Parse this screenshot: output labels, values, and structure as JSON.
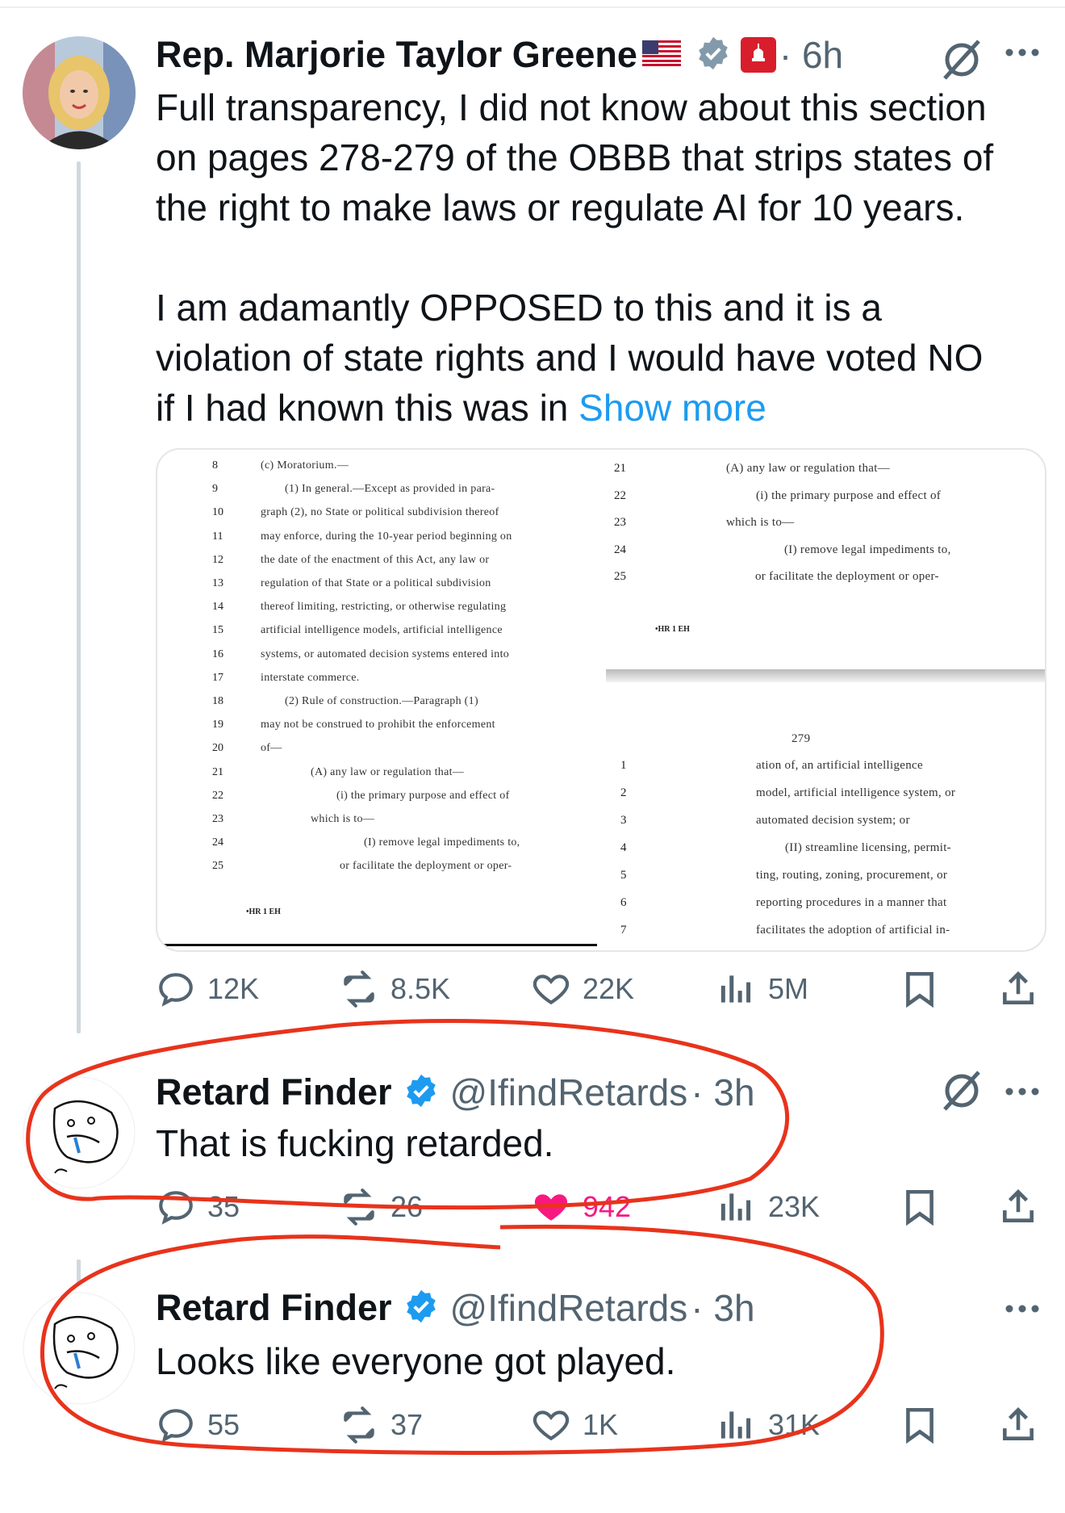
{
  "colors": {
    "accent_link": "#1d9bf0",
    "verified": "#1d9bf0",
    "gop_badge": "#d81e2c",
    "like_active": "#f91880",
    "annotation": "#e8331c",
    "muted": "#536471"
  },
  "posts": [
    {
      "name": "Rep. Marjorie Taylor Greene",
      "flag_icon": "us-flag-icon",
      "verified_icon": "gray-verified-badge-icon",
      "affiliate_icon": "gop-badge-icon",
      "time": "· 6h",
      "body_lines": [
        "Full transparency, I did not know about this section",
        "on pages 278-279 of the OBBB that strips states of",
        "the right to make laws or regulate AI for 10 years.",
        "",
        "I am adamantly OPPOSED to this and it is a",
        "violation of state rights and I would have voted NO",
        "if I had known this was in"
      ],
      "show_more": "Show more",
      "stats": {
        "replies": "12K",
        "reposts": "8.5K",
        "likes": "22K",
        "views": "5M"
      }
    },
    {
      "name": "Retard Finder",
      "verified_icon": "blue-verified-badge-icon",
      "handle": "@IfindRetards",
      "time": "· 3h",
      "body": "That is fucking retarded.",
      "stats": {
        "replies": "35",
        "reposts": "26",
        "likes": "942",
        "views": "23K"
      }
    },
    {
      "name": "Retard Finder",
      "verified_icon": "blue-verified-badge-icon",
      "handle": "@IfindRetards",
      "time": "· 3h",
      "body": "Looks like everyone got played.",
      "stats": {
        "replies": "55",
        "reposts": "37",
        "likes": "1K",
        "views": "31K"
      }
    }
  ],
  "document": {
    "left_numbers": [
      "8",
      "9",
      "10",
      "11",
      "12",
      "13",
      "14",
      "15",
      "16",
      "17",
      "18",
      "19",
      "20",
      "21",
      "22",
      "23",
      "24",
      "25"
    ],
    "left_lines": [
      "(c) Moratorium.—",
      "(1) In general.—Except as provided in para-",
      "graph (2), no State or political subdivision thereof",
      "may enforce, during the 10-year period beginning on",
      "the date of the enactment of this Act, any law or",
      "regulation of that State or a political subdivision",
      "thereof limiting, restricting, or otherwise regulating",
      "artificial intelligence models, artificial intelligence",
      "systems, or automated decision systems entered into",
      "interstate commerce.",
      "(2) Rule of construction.—Paragraph (1)",
      "may not be construed to prohibit the enforcement",
      "of—",
      "(A) any law or regulation that—",
      "(i) the primary purpose and effect of",
      "which is to—",
      "(I) remove legal impediments to,",
      "or facilitate the deployment or oper-"
    ],
    "left_footer": "•HR 1 EH",
    "right_top_numbers": [
      "21",
      "22",
      "23",
      "24",
      "25"
    ],
    "right_top_lines": [
      "(A) any law or regulation that—",
      "(i) the primary purpose and effect of",
      "which is to—",
      "(I) remove legal impediments to,",
      "or facilitate the deployment or oper-"
    ],
    "right_top_footer": "•HR 1 EH",
    "page_number": "279",
    "right_bottom_numbers": [
      "1",
      "2",
      "3",
      "4",
      "5",
      "6",
      "7"
    ],
    "right_bottom_lines": [
      "ation of, an artificial intelligence",
      "model, artificial intelligence system, or",
      "automated decision system; or",
      "(II) streamline licensing, permit-",
      "ting, routing, zoning, procurement, or",
      "reporting procedures in a manner that",
      "facilitates the adoption of artificial in-"
    ]
  }
}
